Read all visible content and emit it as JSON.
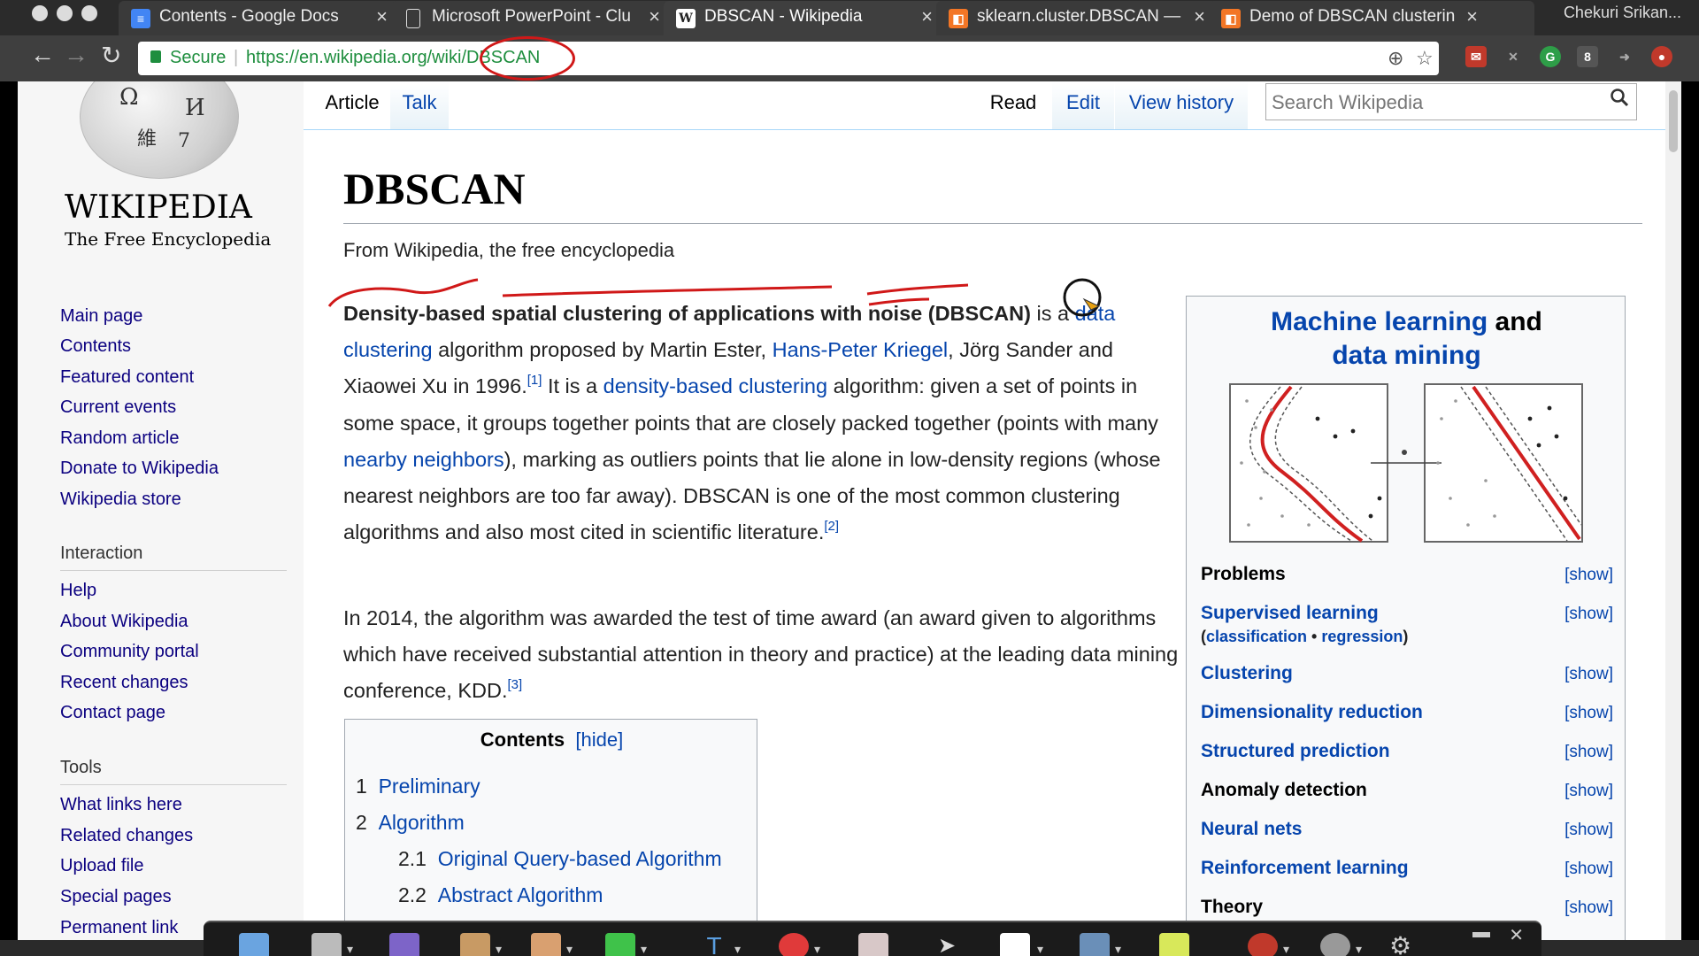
{
  "browser": {
    "tabs": [
      {
        "title": "Contents - Google Docs",
        "favicon": "google-docs-icon",
        "color": "#4285f4"
      },
      {
        "title": "Microsoft PowerPoint - Clu",
        "favicon": "document-icon",
        "color": "#ffffff"
      },
      {
        "title": "DBSCAN - Wikipedia",
        "favicon": "wikipedia-w-icon",
        "color": "#ffffff",
        "active": true
      },
      {
        "title": "sklearn.cluster.DBSCAN —",
        "favicon": "jupyter-icon",
        "color": "#f37626"
      },
      {
        "title": "Demo of DBSCAN clusterin",
        "favicon": "jupyter-icon",
        "color": "#f37626"
      }
    ],
    "profile": "Chekuri Srikan...",
    "secure_label": "Secure",
    "url": "https://en.wikipedia.org/wiki/DBSCAN"
  },
  "sidebar": {
    "wordmark": "WIKIPEDIA",
    "tagline": "The Free Encyclopedia",
    "nav": [
      "Main page",
      "Contents",
      "Featured content",
      "Current events",
      "Random article",
      "Donate to Wikipedia",
      "Wikipedia store"
    ],
    "interaction_heading": "Interaction",
    "interaction": [
      "Help",
      "About Wikipedia",
      "Community portal",
      "Recent changes",
      "Contact page"
    ],
    "tools_heading": "Tools",
    "tools": [
      "What links here",
      "Related changes",
      "Upload file",
      "Special pages",
      "Permanent link"
    ]
  },
  "page_tabs": {
    "article": "Article",
    "talk": "Talk",
    "read": "Read",
    "edit": "Edit",
    "history": "View history",
    "search_placeholder": "Search Wikipedia"
  },
  "article": {
    "title": "DBSCAN",
    "from": "From Wikipedia, the free encyclopedia",
    "p1": {
      "bold": "Density-based spatial clustering of applications with noise",
      "abbr": "(DBSCAN)",
      "t1": " is a ",
      "link1": "data clustering",
      "t2": " algorithm proposed by Martin Ester, ",
      "link2": "Hans-Peter Kriegel",
      "t3": ", Jörg Sander and Xiaowei Xu in 1996.",
      "ref1": "[1]",
      "t4": " It is a ",
      "link3": "density-based clustering",
      "t5": " algorithm: given a set of points in some space, it groups together points that are closely packed together (points with many ",
      "link4": "nearby neighbors",
      "t6": "), marking as outliers points that lie alone in low-density regions (whose nearest neighbors are too far away). DBSCAN is one of the most common clustering algorithms and also most cited in scientific literature.",
      "ref2": "[2]"
    },
    "p2": {
      "text": "In 2014, the algorithm was awarded the test of time award (an award given to algorithms which have received substantial attention in theory and practice) at the leading data mining conference, KDD.",
      "ref": "[3]"
    }
  },
  "toc": {
    "title": "Contents",
    "hide": "[hide]",
    "items": [
      {
        "num": "1",
        "label": "Preliminary"
      },
      {
        "num": "2",
        "label": "Algorithm"
      },
      {
        "num": "2.1",
        "label": "Original Query-based Algorithm"
      },
      {
        "num": "2.2",
        "label": "Abstract Algorithm"
      }
    ]
  },
  "infobox": {
    "title_link1": "Machine learning",
    "title_and": " and",
    "title_link2": "data mining",
    "rows": [
      {
        "label": "Problems",
        "link": false,
        "show": "[show]"
      },
      {
        "label": "Supervised learning",
        "link": true,
        "show": "[show]"
      },
      {
        "label": "Clustering",
        "link": true,
        "show": "[show]"
      },
      {
        "label": "Dimensionality reduction",
        "link": true,
        "show": "[show]"
      },
      {
        "label": "Structured prediction",
        "link": true,
        "show": "[show]"
      },
      {
        "label": "Anomaly detection",
        "link": false,
        "show": "[show]"
      },
      {
        "label": "Neural nets",
        "link": true,
        "show": "[show]"
      },
      {
        "label": "Reinforcement learning",
        "link": true,
        "show": "[show]"
      },
      {
        "label": "Theory",
        "link": false,
        "show": "[show]"
      }
    ],
    "sub_open": "(",
    "sub_classification": "classification",
    "sub_dot": " • ",
    "sub_regression": "regression",
    "sub_close": ")"
  },
  "colors": {
    "link": "#0645ad",
    "ink": "#d01818",
    "secure": "#1e8e3e"
  }
}
